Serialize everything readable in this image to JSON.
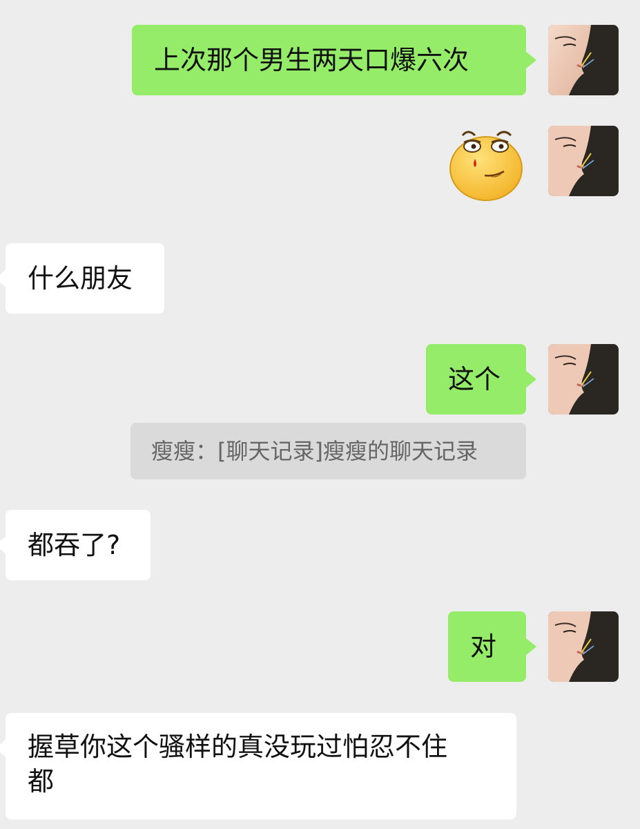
{
  "messages": [
    {
      "side": "sent",
      "text": "上次那个男生两天口爆六次"
    },
    {
      "side": "sent",
      "sticker": "smirking-bleeding-face-icon"
    },
    {
      "side": "received",
      "text": "什么朋友"
    },
    {
      "side": "sent",
      "text": "这个"
    },
    {
      "side": "quote",
      "text": "瘦瘦：[聊天记录]瘦瘦的聊天记录"
    },
    {
      "side": "received",
      "text": "都吞了?"
    },
    {
      "side": "sent",
      "text": "对"
    },
    {
      "side": "received",
      "line1": "握草你这个骚样的真没玩过怕忍不住",
      "line2": "都"
    }
  ],
  "colors": {
    "background": "#ededed",
    "sent_bubble": "#95ec69",
    "received_bubble": "#ffffff",
    "quote_bg": "#dadada"
  }
}
